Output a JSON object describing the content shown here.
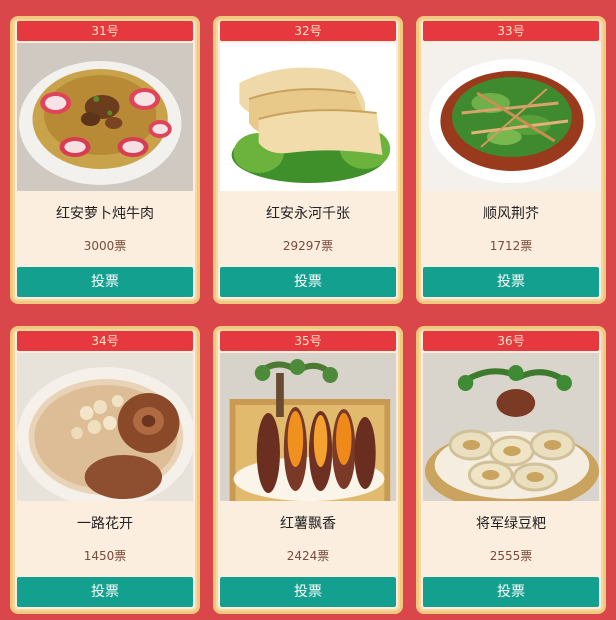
{
  "vote_label": "投票",
  "items": [
    {
      "number": "31号",
      "name": "红安萝卜炖牛肉",
      "votes": "3000票"
    },
    {
      "number": "32号",
      "name": "红安永河千张",
      "votes": "29297票"
    },
    {
      "number": "33号",
      "name": "顺风荆芥",
      "votes": "1712票"
    },
    {
      "number": "34号",
      "name": "一路花开",
      "votes": "1450票"
    },
    {
      "number": "35号",
      "name": "红薯飘香",
      "votes": "2424票"
    },
    {
      "number": "36号",
      "name": "将军绿豆粑",
      "votes": "2555票"
    }
  ]
}
